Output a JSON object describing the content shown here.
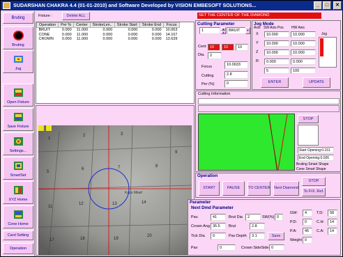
{
  "title": "SUDARSHAN CHAKRA 4.4 (01-01-2010)      and Software Developed by VISION EMBESOFT SOLUTIONS...",
  "window_buttons": {
    "min": "_",
    "max": "□",
    "close": "✕"
  },
  "sidebar": {
    "top_tab": "Bruting",
    "items": [
      {
        "label": "Bruting",
        "icon": "black-circle-icon"
      },
      {
        "label": "Jog",
        "icon": "jog-icon"
      },
      {
        "label": "Open Fixture",
        "icon": "open-fixture-icon"
      },
      {
        "label": "Save Fixture",
        "icon": "save-fixture-icon"
      },
      {
        "label": "Settings...",
        "icon": "settings-icon"
      },
      {
        "label": "SmartSet",
        "icon": "smartset-icon"
      },
      {
        "label": "XYZ Home",
        "icon": "xyz-home-icon"
      },
      {
        "label": "Cone Home",
        "icon": "cone-home-icon"
      }
    ],
    "card_setting": "Card Setting",
    "operation": "Operation"
  },
  "fixture": {
    "label": "Fixture :",
    "delete_all": "Delete ALL",
    "columns": [
      "Operation",
      "Per %",
      "Center",
      "StrokeLen..",
      "Stroke Start",
      "Stroke End",
      "Focus"
    ],
    "rows": [
      [
        "BRUIT",
        "0.000",
        "11.000",
        "0.000",
        "0.000",
        "0.000",
        "10.063"
      ],
      [
        "CONE",
        "0.000",
        "11.000",
        "0.000",
        "0.000",
        "0.000",
        "14.107"
      ],
      [
        "CROWN",
        "0.000",
        "11.000",
        "0.000",
        "0.000",
        "0.000",
        "13.639"
      ]
    ]
  },
  "status_message": "SET THE CENTER OF THE DIAMOND",
  "cutting_parameter": {
    "title": "Cutting Parameter",
    "number": "1",
    "operation": "BRUIT",
    "cent_label": "Cent",
    "cent_values": [
      "10",
      "10",
      "10"
    ],
    "dia_label": "Dia.",
    "dia": "2",
    "focus_label": "Focus",
    "focus": "10.0633",
    "cutting_label": "Cutting",
    "cutting": "2.8",
    "per_label": "Per (%)",
    "per": "0"
  },
  "jog_mode": {
    "title": "Jog Mode",
    "axis_header": "Axis",
    "sw_header": "SW Axis Pos",
    "hw_header": "HW Axis",
    "jog_header": "Jog",
    "axes": [
      {
        "name": "X",
        "sw": "10.000",
        "hw": "10.000"
      },
      {
        "name": "Y",
        "sw": "10.000",
        "hw": "10.000"
      },
      {
        "name": "Z",
        "sw": "10.000",
        "hw": "10.000"
      },
      {
        "name": "R",
        "sw": "0.000",
        "hw": "0.000"
      }
    ],
    "step1": "5",
    "step2": "100",
    "enter": "ENTER",
    "update": "UPDATE"
  },
  "cutting_information": {
    "title": "Cutting Information",
    "stop": "STOP",
    "start_opening": "Start Opening:0.151",
    "end_opening": "End  Opening:0.026",
    "shape1": "Bruting Smart Shape",
    "shape2": "Cone Smart Shape"
  },
  "operation": {
    "title": "Operation",
    "start": "START",
    "pause": "PAUSE",
    "to_center": "TO CENTER",
    "next_diamond": "Next Diamond",
    "to_fix_ref": "To FIX. Ref."
  },
  "parameter": {
    "title": "Parameter",
    "subtitle": "Next Dmd Parameter",
    "pav_label": "Pav.",
    "pav": "41",
    "brut_dia_label": "Brut Dia",
    "brut_dia": "2",
    "sw_label": "SW(%)",
    "sw": "0",
    "crown_ang_label": "Crown Ang",
    "crown_ang": "35.5",
    "brut_label": "Brut",
    "brut": "2.8",
    "tick_dia_label": "Tick Dia",
    "tick_dia": "0",
    "pav_depth_label": "Pav Depth",
    "pav_depth": "3.1",
    "save": "Save",
    "pav2_label": "Pav",
    "pav2": "0",
    "crown_side_label": "Crown SideSide",
    "crown_side": "0",
    "right": [
      {
        "l1": "GW:",
        "v1": "4",
        "l2": "T.D:",
        "v2": "58"
      },
      {
        "l1": "P.D:",
        "v1": "0",
        "l2": "C.H:",
        "v2": "14"
      },
      {
        "l1": "P.A:",
        "v1": "45",
        "l2": "C.A:",
        "v2": "14"
      },
      {
        "l1": "Weight",
        "v1": "0",
        "l2": "",
        "v2": ""
      }
    ]
  },
  "camera": {
    "grid_numbers": [
      "1",
      "2",
      "3",
      "5",
      "6",
      "7",
      "8",
      "9",
      "11",
      "12",
      "13",
      "14",
      "17",
      "18",
      "19",
      "20"
    ],
    "label_text": "Kaps Mkarl"
  },
  "colors": {
    "accent_red": "#ff1010",
    "green_area": "#2ee82e",
    "title_blue": "#0a2a8c",
    "pink_bg": "#fbd6f7"
  }
}
